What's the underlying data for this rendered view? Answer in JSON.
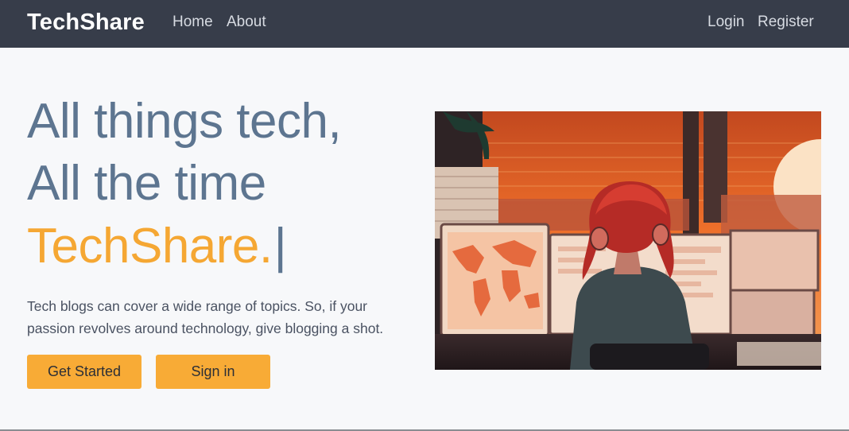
{
  "nav": {
    "brand": "TechShare",
    "links": [
      "Home",
      "About"
    ],
    "auth": [
      "Login",
      "Register"
    ]
  },
  "hero": {
    "line1": "All things tech,",
    "line2": "All the time",
    "line3": "TechShare.",
    "cursor": "|",
    "description": "Tech blogs can cover a wide range of topics. So, if your passion revolves around technology, give blogging a shot.",
    "buttons": {
      "get_started": "Get Started",
      "sign_in": "Sign in"
    }
  },
  "colors": {
    "navbar": "#373d4a",
    "accent": "#f5a733",
    "heading": "#5d7590",
    "background": "#f7f8fa"
  }
}
